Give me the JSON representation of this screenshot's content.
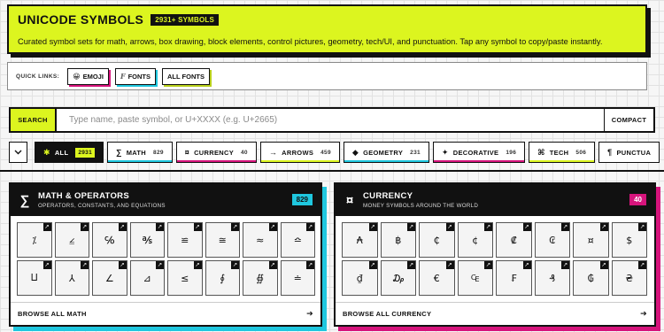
{
  "hero": {
    "title": "UNICODE SYMBOLS",
    "badge": "2931+ SYMBOLS",
    "description": "Curated symbol sets for math, arrows, box drawing, block elements, control pictures, geometry, tech/UI, and punctuation. Tap any symbol to copy/paste instantly."
  },
  "quick_links": {
    "label": "QUICK LINKS:",
    "items": [
      {
        "icon": "😀",
        "label": "EMOJI"
      },
      {
        "icon": "F",
        "label": "FONTS"
      },
      {
        "icon": "",
        "label": "ALL FONTS"
      }
    ]
  },
  "search": {
    "label": "SEARCH",
    "placeholder": "Type name, paste symbol, or U+XXXX (e.g. U+2665)",
    "value": "",
    "compact_label": "COMPACT"
  },
  "tabs": [
    {
      "icon": "✱",
      "label": "ALL",
      "count": "2931"
    },
    {
      "icon": "∑",
      "label": "MATH",
      "count": "829"
    },
    {
      "icon": "¤",
      "label": "CURRENCY",
      "count": "40"
    },
    {
      "icon": "→",
      "label": "ARROWS",
      "count": "459"
    },
    {
      "icon": "◆",
      "label": "GEOMETRY",
      "count": "231"
    },
    {
      "icon": "✦",
      "label": "DECORATIVE",
      "count": "196"
    },
    {
      "icon": "⌘",
      "label": "TECH",
      "count": "506"
    },
    {
      "icon": "¶",
      "label": "PUNCTUA",
      "count": ""
    }
  ],
  "cards": {
    "math": {
      "icon": "∑",
      "title": "MATH & OPERATORS",
      "subtitle": "OPERATORS, CONSTANTS, AND EQUATIONS",
      "count": "829",
      "symbols": [
        "⁒",
        "⦤",
        "℅",
        "℁",
        "≌",
        "≅",
        "≈",
        "≏",
        "⨿",
        "⅄",
        "∠",
        "⊿",
        "≤",
        "∮",
        "∯",
        "≐"
      ],
      "footer": "BROWSE ALL MATH"
    },
    "currency": {
      "icon": "¤",
      "title": "CURRENCY",
      "subtitle": "MONEY SYMBOLS AROUND THE WORLD",
      "count": "40",
      "symbols": [
        "₳",
        "฿",
        "₵",
        "¢",
        "₡",
        "₢",
        "¤",
        "$",
        "₫",
        "₯",
        "€",
        "₠",
        "₣",
        "₰",
        "₲",
        "₴"
      ],
      "footer": "BROWSE ALL CURRENCY"
    }
  },
  "colors": {
    "accent_lime": "#dcf51f",
    "accent_cyan": "#1fc7df",
    "accent_magenta": "#d6147c",
    "ink": "#111111"
  }
}
